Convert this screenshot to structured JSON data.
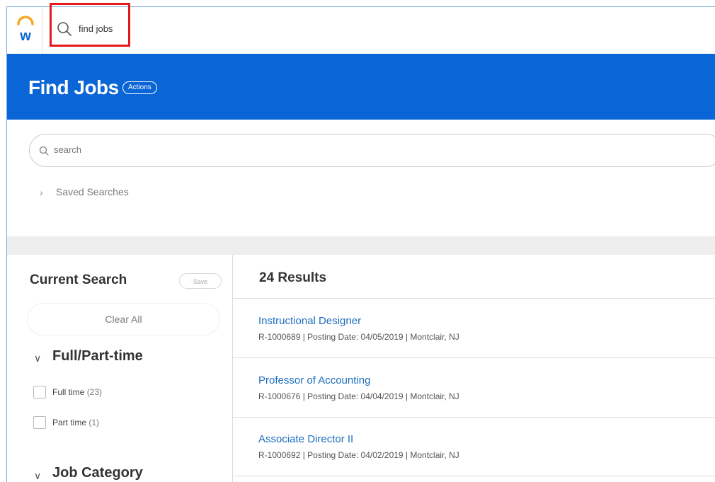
{
  "colors": {
    "brand_blue": "#0a66d6",
    "link_blue": "#1d6dc0",
    "highlight_red": "#e3191b"
  },
  "topbar": {
    "logo_icon": "workday-logo-icon",
    "search_icon": "search-icon",
    "search_text": "find jobs"
  },
  "header": {
    "title": "Find Jobs",
    "actions_label": "Actions"
  },
  "search": {
    "placeholder": "search",
    "saved_searches_label": "Saved Searches"
  },
  "current_search": {
    "title": "Current Search",
    "save_label": "Save",
    "clear_all_label": "Clear All"
  },
  "facets": [
    {
      "title": "Full/Part-time",
      "options": [
        {
          "label": "Full time",
          "count": "(23)"
        },
        {
          "label": "Part time",
          "count": "(1)"
        }
      ]
    },
    {
      "title": "Job Category",
      "options": []
    }
  ],
  "results": {
    "count_label": "24 Results",
    "jobs": [
      {
        "title": "Instructional Designer",
        "meta": "R-1000689  |  Posting Date: 04/05/2019  |  Montclair, NJ"
      },
      {
        "title": "Professor of Accounting",
        "meta": "R-1000676  |  Posting Date: 04/04/2019  |  Montclair, NJ"
      },
      {
        "title": "Associate Director II",
        "meta": "R-1000692  |  Posting Date: 04/02/2019  |  Montclair, NJ"
      }
    ]
  }
}
